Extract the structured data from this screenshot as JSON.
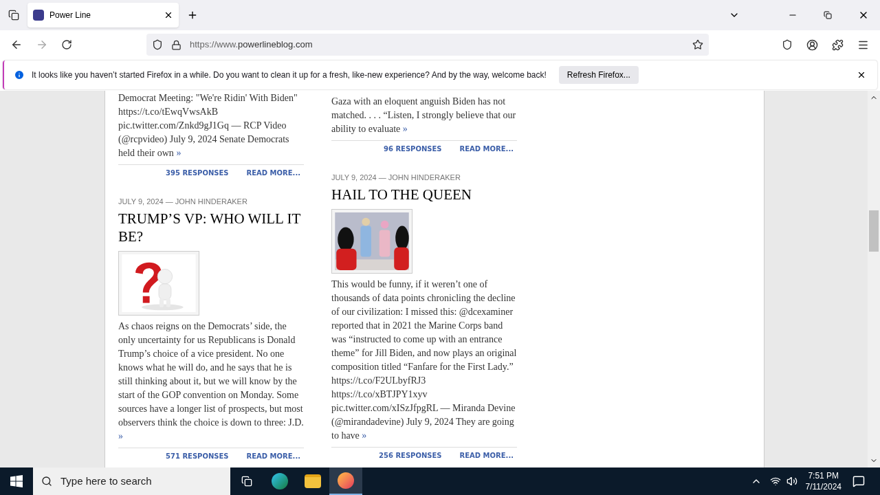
{
  "browser": {
    "tabs": [
      {
        "title": "Power Line",
        "selected": true
      }
    ],
    "url_prefix": "https://www.",
    "url_domain": "powerlineblog.com"
  },
  "notification": {
    "message": "It looks like you haven’t started Firefox in a while. Do you want to clean it up for a fresh, like-new experience? And by the way, welcome back!",
    "button": "Refresh Firefox..."
  },
  "columns": [
    {
      "posts": [
        {
          "kind": "continued",
          "excerpt": "Democrat Meeting: \"We're Ridin' With Biden\" https://t.co/tEwqVwsAkB pic.twitter.com/Znkd9gJ1Gq — RCP Video (@rcpvideo) July 9, 2024 Senate Democrats held their own",
          "more": "»",
          "responses": "395 RESPONSES",
          "read_more": "READ MORE..."
        },
        {
          "kind": "full",
          "meta": "JULY 9, 2024 — JOHN HINDERAKER",
          "title": "TRUMP’S VP: WHO WILL IT BE?",
          "excerpt": "As chaos reigns on the Democrats’ side, the only uncertainty for us Republicans is Donald Trump’s choice of a vice president. No one knows what he will do, and he says that he is still thinking about it, but we will know by the start of the GOP convention on Monday. Some sources have a longer list of prospects, but most observers think the choice is down to three: J.D.",
          "more": "»",
          "responses": "571 RESPONSES",
          "read_more": "READ MORE..."
        }
      ]
    },
    {
      "posts": [
        {
          "kind": "continued",
          "excerpt": "Gaza with an eloquent anguish Biden has not matched. . . . “Listen, I strongly believe that our ability to evaluate",
          "more": "»",
          "responses": "96 RESPONSES",
          "read_more": "READ MORE..."
        },
        {
          "kind": "full",
          "meta": "JULY 9, 2024 — JOHN HINDERAKER",
          "title": "HAIL TO THE QUEEN",
          "excerpt": "This would be funny, if it weren’t one of thousands of data points chronicling the decline of our civilization: I missed this: @dcexaminer reported that in 2021 the Marine Corps band was “instructed to come up with an entrance theme” for Jill Biden, and now plays an original composition titled “Fanfare for the First Lady.” https://t.co/F2ULbyfRJ3 https://t.co/xBTJPY1xyv pic.twitter.com/xISzJfpgRL — Miranda Devine (@mirandadevine) July 9, 2024 They are going to have",
          "more": "»",
          "responses": "256 RESPONSES",
          "read_more": "READ MORE..."
        }
      ]
    }
  ],
  "taskbar": {
    "search_placeholder": "Type here to search",
    "time": "7:51 PM",
    "date": "7/11/2024"
  }
}
